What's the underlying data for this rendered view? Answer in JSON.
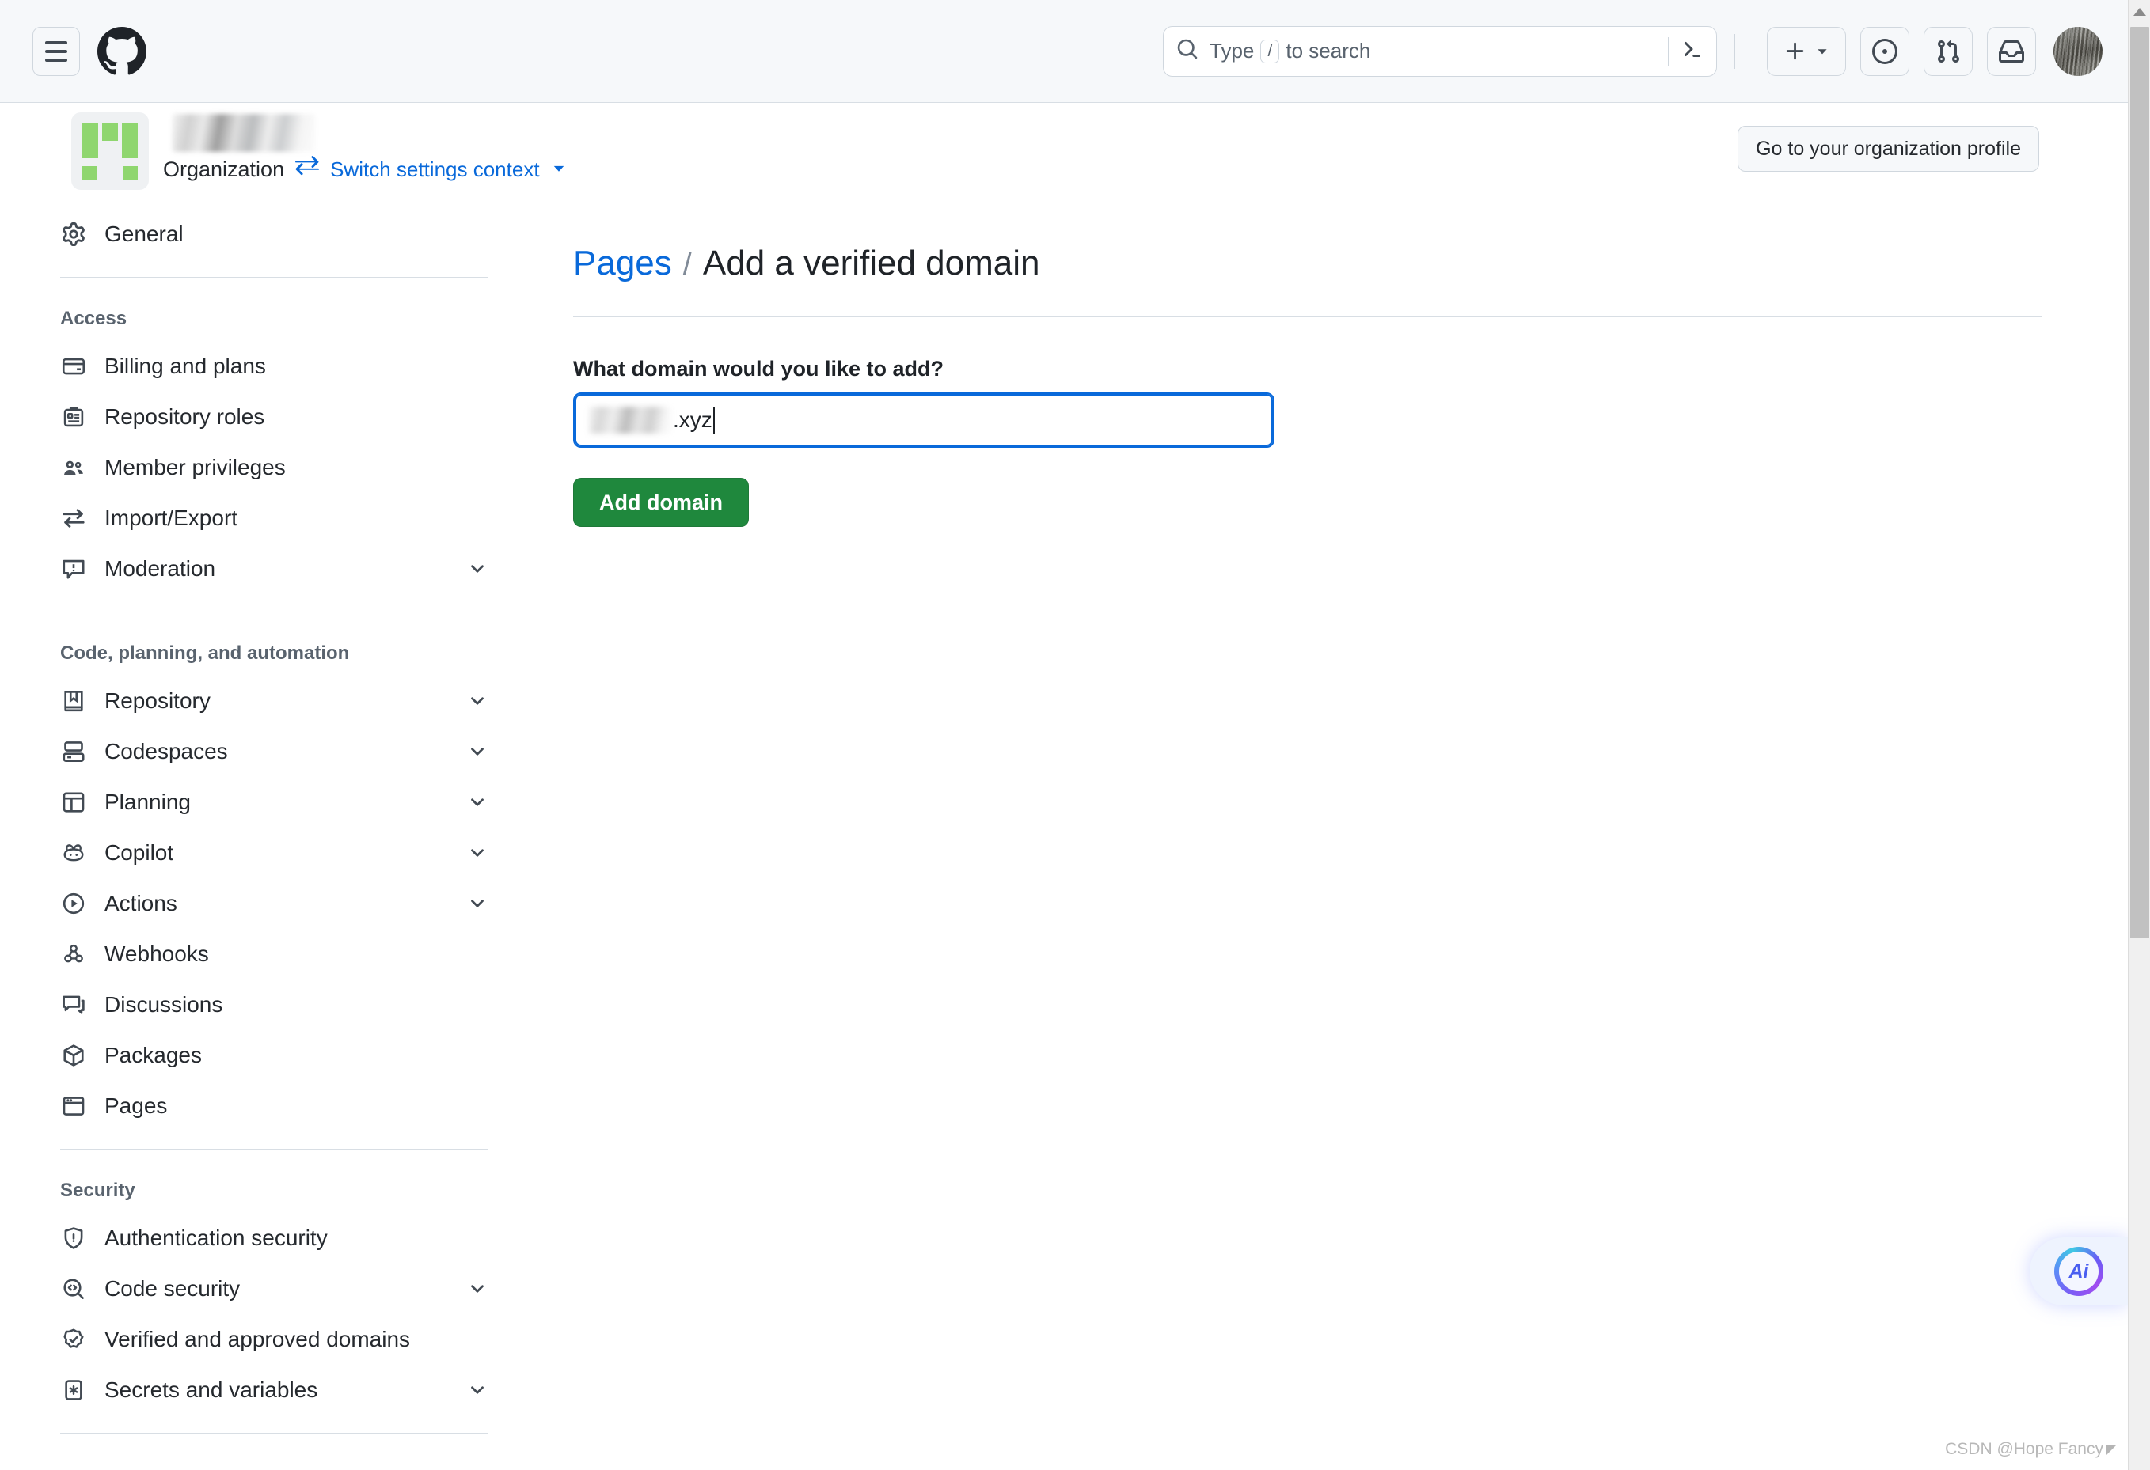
{
  "header": {
    "menu_icon": "hamburger-icon",
    "logo_icon": "github-logo-icon",
    "search": {
      "icon": "search-icon",
      "prefix": "Type",
      "key_badge": "/",
      "suffix": "to search",
      "terminal_icon": "terminal-icon",
      "placeholder": "Type / to search"
    },
    "actions": [
      {
        "name": "create-new-button",
        "icon": "plus-icon",
        "has_dropdown": true
      },
      {
        "name": "issues-button",
        "icon": "issue-opened-icon"
      },
      {
        "name": "pull-requests-button",
        "icon": "git-pull-request-icon"
      },
      {
        "name": "notifications-button",
        "icon": "inbox-icon"
      }
    ],
    "avatar": "user-avatar"
  },
  "org": {
    "avatar_icon": "organization-avatar",
    "name": "",
    "type_label": "Organization",
    "switch_icon": "arrow-switch-icon",
    "switch_label": "Switch settings context",
    "profile_button": "Go to your organization profile"
  },
  "sidebar": {
    "top_items": [
      {
        "label": "General",
        "icon": "gear-icon",
        "chevron": false
      }
    ],
    "sections": [
      {
        "title": "Access",
        "items": [
          {
            "label": "Billing and plans",
            "icon": "credit-card-icon",
            "chevron": false
          },
          {
            "label": "Repository roles",
            "icon": "id-badge-icon",
            "chevron": false
          },
          {
            "label": "Member privileges",
            "icon": "people-icon",
            "chevron": false
          },
          {
            "label": "Import/Export",
            "icon": "arrow-switch-icon",
            "chevron": false
          },
          {
            "label": "Moderation",
            "icon": "report-icon",
            "chevron": true
          }
        ]
      },
      {
        "title": "Code, planning, and automation",
        "items": [
          {
            "label": "Repository",
            "icon": "repo-icon",
            "chevron": true
          },
          {
            "label": "Codespaces",
            "icon": "codespaces-icon",
            "chevron": true
          },
          {
            "label": "Planning",
            "icon": "project-icon",
            "chevron": true
          },
          {
            "label": "Copilot",
            "icon": "copilot-icon",
            "chevron": true
          },
          {
            "label": "Actions",
            "icon": "play-icon",
            "chevron": true
          },
          {
            "label": "Webhooks",
            "icon": "webhook-icon",
            "chevron": false
          },
          {
            "label": "Discussions",
            "icon": "comment-discussion-icon",
            "chevron": false
          },
          {
            "label": "Packages",
            "icon": "package-icon",
            "chevron": false
          },
          {
            "label": "Pages",
            "icon": "browser-icon",
            "chevron": false
          }
        ]
      },
      {
        "title": "Security",
        "items": [
          {
            "label": "Authentication security",
            "icon": "shield-lock-icon",
            "chevron": false
          },
          {
            "label": "Code security",
            "icon": "codescan-icon",
            "chevron": true
          },
          {
            "label": "Verified and approved domains",
            "icon": "verified-icon",
            "chevron": false
          },
          {
            "label": "Secrets and variables",
            "icon": "key-asterisk-icon",
            "chevron": true
          }
        ]
      }
    ]
  },
  "main": {
    "breadcrumb": {
      "parent": "Pages",
      "separator": "/",
      "current": "Add a verified domain"
    },
    "form": {
      "question_label": "What domain would you like to add?",
      "domain_value_visible": ".xyz",
      "submit_label": "Add domain"
    }
  },
  "ai_widget": {
    "label": "Ai"
  },
  "watermark": {
    "text": "CSDN @Hope Fancy"
  },
  "colors": {
    "accent_blue": "#0969da",
    "success_green": "#1f883d",
    "header_bg": "#f6f8fa",
    "border": "#d0d7de",
    "text": "#1f2328",
    "muted_text": "#59636e",
    "org_avatar_green": "#8fd66f"
  }
}
